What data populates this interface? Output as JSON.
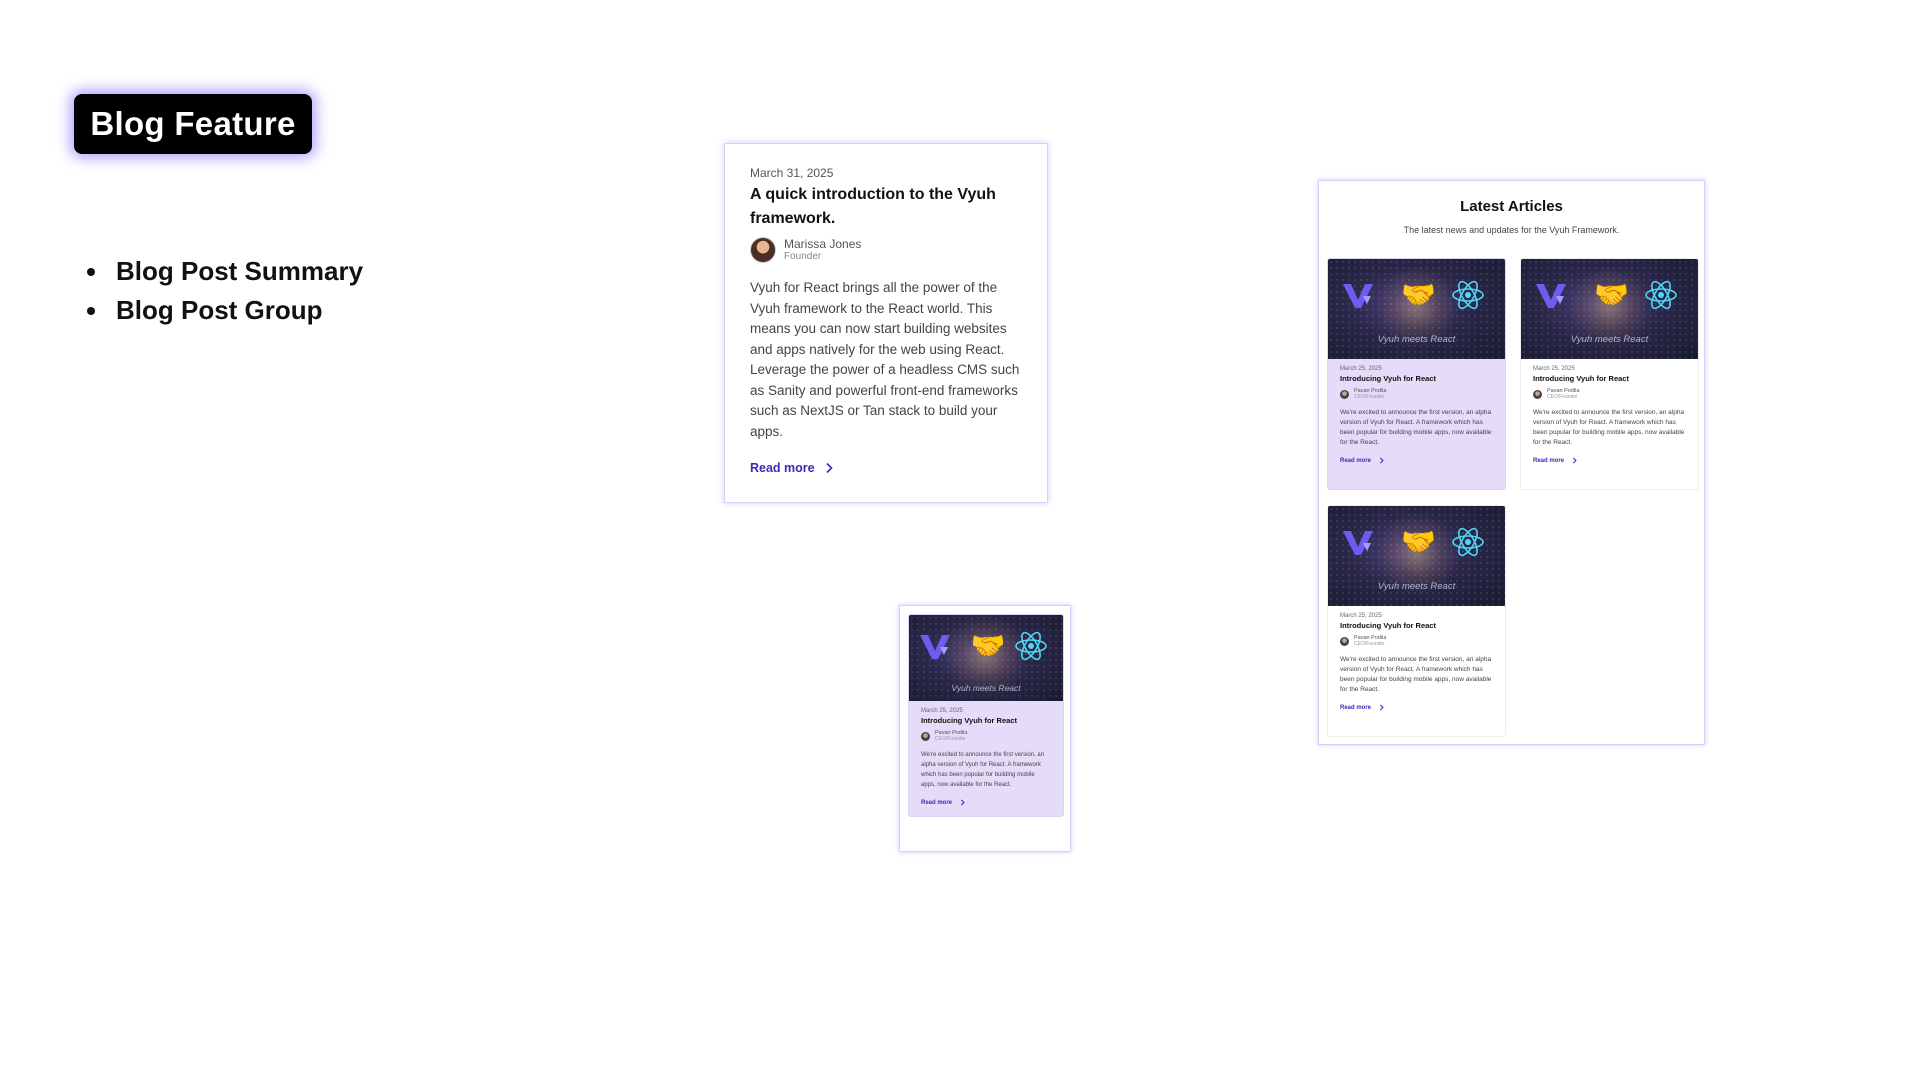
{
  "badge": {
    "label": "Blog Feature"
  },
  "bullets": [
    "Blog Post Summary",
    "Blog Post Group"
  ],
  "summary_card": {
    "date": "March 31, 2025",
    "title": "A quick introduction to the Vyuh framework.",
    "author_name": "Marissa Jones",
    "author_role": "Founder",
    "body": "Vyuh for React brings all the power of the Vyuh framework to the React world. This means you can now start building websites and apps natively for the web using React. Leverage the power of a headless CMS such as Sanity and powerful front-end frameworks such as NextJS or Tan stack to build your apps.",
    "read_more": "Read more"
  },
  "post": {
    "hero_caption": "Vyuh meets React",
    "date": "March 25, 2025",
    "title": "Introducing Vyuh for React",
    "author_name": "Pavan Podila",
    "author_role": "CEO/Founder",
    "excerpt": "We're excited to announce the first version, an alpha version of Vyuh for React. A framework which has been popular for building mobile apps, now available for the React.",
    "read_more": "Read more"
  },
  "group": {
    "title": "Latest Articles",
    "subtitle": "The latest news and updates for the Vyuh Framework."
  },
  "icons": [
    "vyuh-logo-icon",
    "handshake-icon",
    "react-logo-icon",
    "chevron-right-icon"
  ],
  "colors": {
    "accent": "#3a2ab8",
    "highlight_card": "#e4dcf8",
    "badge_bg": "#000000",
    "badge_glow": "#6e5aff"
  }
}
